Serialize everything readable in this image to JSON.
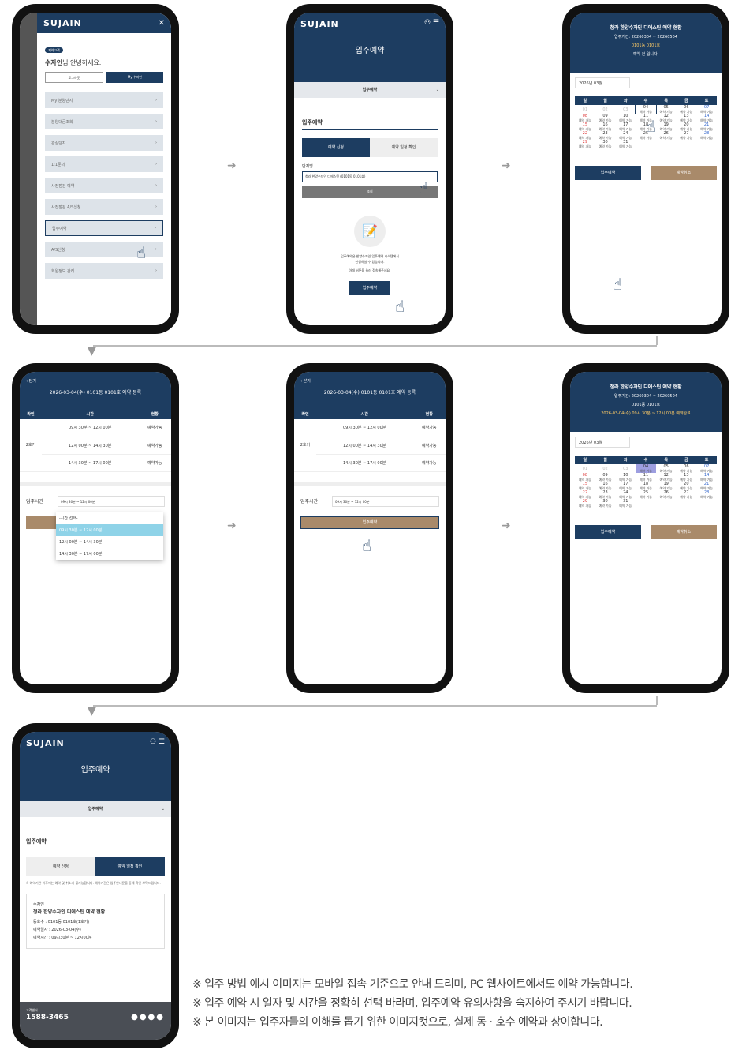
{
  "brand": "SUJAIN",
  "s1": {
    "badge": "계약고객",
    "greet_name": "수자인",
    "greet_rest": "님 안녕하세요.",
    "logout": "로그아웃",
    "my": "My 수자인",
    "menu": [
      "My 분양단지",
      "분양대금조회",
      "관심단지",
      "1:1문의",
      "사전점검 예약",
      "사전점검 A/S신청",
      "입주예약",
      "A/S신청",
      "회원정보 관리"
    ]
  },
  "s2": {
    "page_title": "입주예약",
    "dropdown": "입주예약",
    "section": "입주예약",
    "tab1": "예약 신청",
    "tab2": "예약 일정 확인",
    "field_label": "단지명",
    "field_value": "청라 한양수자인 디에스틴 (0101동 0101호)",
    "search_btn": "조회",
    "info1": "입주예약은 한양수자인 입주예약 시스템에서",
    "info2": "신청하실 수 있습니다.",
    "info3": "아래 버튼을 눌러 접속해주세요.",
    "go_btn": "입주예약"
  },
  "s3": {
    "title": "청라 한양수자인 디에스틴 예약 현황",
    "period": "입주기간: 20260304 ~ 20260504",
    "unit": "0101동 0101호",
    "status": "예약 전 입니다.",
    "month": "2026년 03월",
    "weekdays": [
      "일",
      "월",
      "화",
      "수",
      "목",
      "금",
      "토"
    ],
    "avail": "예약 가능",
    "btn_reserve": "입주예약",
    "btn_cancel": "예약취소"
  },
  "s4": {
    "close": "닫기",
    "title": "2026-03-04(수) 0101동 0101호 예약 등록",
    "th": [
      "라인",
      "시간",
      "현황"
    ],
    "line": "2호기",
    "slots": [
      "09시 30분 ~ 12시 00분",
      "12시 00분 ~ 14시 30분",
      "14시 30분 ~ 17시 00분"
    ],
    "slot_status": "예약가능",
    "time_label": "입주시간",
    "time_value": "09시 30분 ~ 12시 00분",
    "opt_default": "-시간 선택-",
    "reserve_btn": "입주예약"
  },
  "s6": {
    "title": "청라 한양수자인 디에스틴 예약 현황",
    "period": "입주기간: 20260304 ~ 20260504",
    "unit": "0101동 0101호",
    "status": "2026-03-04(수) 09시 30분 ~ 12시 00분 예약완료"
  },
  "s7": {
    "page_title": "입주예약",
    "dropdown": "입주예약",
    "section": "입주예약",
    "tab1": "예약 신청",
    "tab2": "예약 일정 확인",
    "note": "※ 예약기간 이후에는 예약 및 취소가 불가능합니다. 예약기간은 입주안내문을 통해 확인 부탁드립니다.",
    "card_label": "수자인",
    "card_title": "청라 한양수자인 디에스틴 예약 현황",
    "card_l1": "동호수 : 0101동 0101호(1호기)",
    "card_l2": "예약일자 : 2026-03-04(수)",
    "card_l3": "예약시간 : 09시30분 ~ 12시00분",
    "cs_label": "고객센터",
    "phone": "1588-3465"
  },
  "notes": [
    "※ 입주 방법 예시 이미지는 모바일 접속 기준으로 안내 드리며, PC 웹사이트에서도 예약 가능합니다.",
    "※ 입주 예약 시 일자 및 시간을 정확히 선택 바라며, 입주예약 유의사항을 숙지하여 주시기 바랍니다.",
    "※ 본 이미지는 입주자들의 이해를 돕기 위한 이미지컷으로, 실제 동 · 호수 예약과 상이합니다."
  ]
}
